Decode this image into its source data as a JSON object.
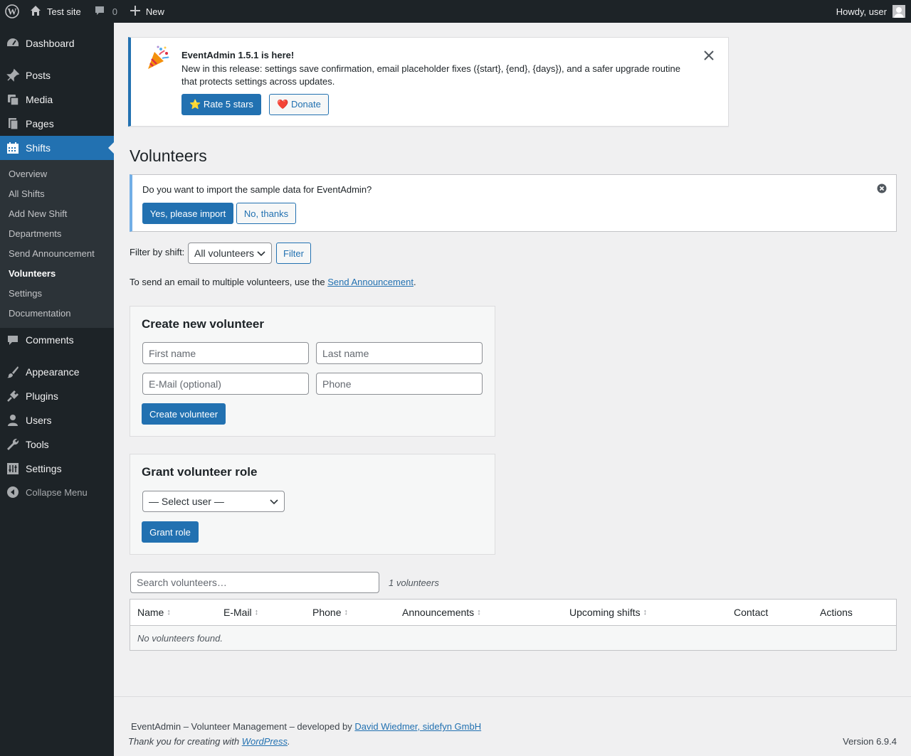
{
  "admin_bar": {
    "site_name": "Test site",
    "comments_count": "0",
    "new_label": "New",
    "greeting": "Howdy, user"
  },
  "sidebar": {
    "items": [
      {
        "label": "Dashboard",
        "icon": "dashboard-icon"
      },
      {
        "label": "Posts",
        "icon": "pin-icon"
      },
      {
        "label": "Media",
        "icon": "media-icon"
      },
      {
        "label": "Pages",
        "icon": "pages-icon"
      },
      {
        "label": "Shifts",
        "icon": "calendar-icon"
      },
      {
        "label": "Comments",
        "icon": "comment-icon"
      },
      {
        "label": "Appearance",
        "icon": "brush-icon"
      },
      {
        "label": "Plugins",
        "icon": "plug-icon"
      },
      {
        "label": "Users",
        "icon": "user-icon"
      },
      {
        "label": "Tools",
        "icon": "wrench-icon"
      },
      {
        "label": "Settings",
        "icon": "settings-icon"
      },
      {
        "label": "Collapse Menu",
        "icon": "collapse-icon"
      }
    ],
    "submenu": [
      "Overview",
      "All Shifts",
      "Add New Shift",
      "Departments",
      "Send Announcement",
      "Volunteers",
      "Settings",
      "Documentation"
    ],
    "current_submenu": "Volunteers"
  },
  "update_notice": {
    "title": "EventAdmin 1.5.1 is here!",
    "text": "New in this release: settings save confirmation, email placeholder fixes ({start}, {end}, {days}), and a safer upgrade routine that protects settings across updates.",
    "rate_label": "⭐ Rate 5 stars",
    "donate_label": "❤️ Donate"
  },
  "page_title": "Volunteers",
  "import_notice": {
    "text": "Do you want to import the sample data for EventAdmin?",
    "yes_label": "Yes, please import",
    "no_label": "No, thanks"
  },
  "filter": {
    "label": "Filter by shift:",
    "selected": "All volunteers",
    "button": "Filter"
  },
  "info": {
    "prefix": "To send an email to multiple volunteers, use the ",
    "link": "Send Announcement",
    "suffix": "."
  },
  "create_panel": {
    "title": "Create new volunteer",
    "first_name_placeholder": "First name",
    "last_name_placeholder": "Last name",
    "email_placeholder": "E-Mail (optional)",
    "phone_placeholder": "Phone",
    "button": "Create volunteer"
  },
  "grant_panel": {
    "title": "Grant volunteer role",
    "select_value": "— Select user —",
    "button": "Grant role"
  },
  "search": {
    "placeholder": "Search volunteers…",
    "count": "1 volunteers"
  },
  "table": {
    "columns": [
      {
        "label": "Name",
        "sortable": true
      },
      {
        "label": "E-Mail",
        "sortable": true
      },
      {
        "label": "Phone",
        "sortable": true
      },
      {
        "label": "Announcements",
        "sortable": true
      },
      {
        "label": "Upcoming shifts",
        "sortable": true
      },
      {
        "label": "Contact",
        "sortable": false
      },
      {
        "label": "Actions",
        "sortable": false
      }
    ],
    "empty_text": "No volunteers found."
  },
  "footer": {
    "credit_prefix": "EventAdmin – Volunteer Management – developed by ",
    "credit_link": "David Wiedmer, sidefyn GmbH",
    "thanks_prefix": "Thank you for creating with ",
    "thanks_link": "WordPress",
    "thanks_suffix": ".",
    "version": "Version 6.9.4"
  },
  "colors": {
    "accent": "#2271b1",
    "sidebar_bg": "#1d2327",
    "submenu_bg": "#2c3338",
    "info_border": "#72aee6"
  }
}
